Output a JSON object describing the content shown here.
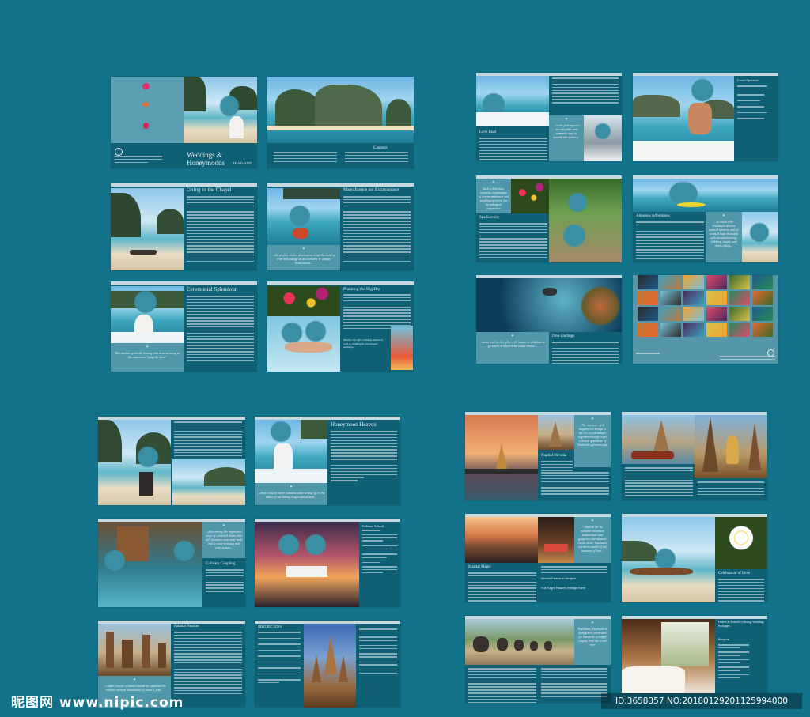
{
  "brochure": {
    "cover_title": "Weddings & Honeymoons",
    "brand": "THAILAND",
    "contents_heading": "Contents",
    "contents_items": [
      "Going to the Chapel",
      "Ceremonial Splendour",
      "Magnificence not Extravagance",
      "Planning the Big Day",
      "Honeymoon Heaven",
      "Culinary Coupling",
      "Palatial Passion",
      "Nuptial Nirvana",
      "Marital Magic",
      "Celebration of Love"
    ]
  },
  "pages": {
    "chapel": {
      "title": "Going to the Chapel"
    },
    "magnificence": {
      "title": "Magnificence not Extravagance",
      "quote": "...the perfect shelter destination to set the bond of love and indulge in an exclusive & unique honeymoon..."
    },
    "ceremonial": {
      "title": "Ceremonial Splendour",
      "quote": "This ancient symbolic joining rain term meaning to the expressive \"tying the knot\""
    },
    "planning": {
      "title": "Planning the Big Day",
      "quote": "Website list offer wedding advice as well as wedding & honeymoon packages"
    },
    "love_boat": {
      "title": "Love Boat",
      "quote": "...exotic journeys are an enjoyable and romantic way to unearth the scenery..."
    },
    "cruise_list": {
      "heading": "Cruise Operators"
    },
    "spa": {
      "title": "Spa Serenity",
      "quote": "Such a delicious, relaxing combination of serene ambience and soothing services, for an indulgent experience"
    },
    "amorous": {
      "title": "Amorous Adventures",
      "quote": "...to touch with Thailand's diverse natural scenery, and on a small bush thousand with mountaineering, trekking, jungle, and river rafting..."
    },
    "dive": {
      "title": "Dive Darlings",
      "quote": "...swim with turtles, play with turquoise dolphins or go shark or black-head whale sharks..."
    },
    "honeymoon_heaven": {
      "title": "Honeymoon Heaven",
      "quote": "...what could be more romantic than setting off in the allure of our breezy long tropical land..."
    },
    "culinary_schools": {
      "title": "Culinary Schools"
    },
    "culinary_coupling": {
      "title": "Culinary Coupling",
      "quote": "...discovering the impressive ways of colourful dishes that will stimulate your taste buds and so your honours and your senses..."
    },
    "palatial": {
      "title": "Palatial Passion",
      "quote": "...couple's hands to stand around the impressively ancient cultural monuments of historic past..."
    },
    "historic_sites": {
      "heading": "HISTORIC SITES"
    },
    "nuptial": {
      "title": "Nuptial Nirvana",
      "quote": "The romance of a happier era beings to the air as you sample together through local colonial splendour of Thailand's glorious past"
    },
    "marital": {
      "title": "Marital Magic",
      "quote": "...famous for its romantic mountain temperature and gorgeous and majestic chedis & the Thailand's northern citadel of the romance of love..."
    },
    "marital_sub": {
      "title": "Mahidol Palaces in Bangkok",
      "line2": "H.M. King's Palace's Heritage Home"
    },
    "celebration": {
      "title": "Celebration of Love"
    },
    "elephant": {
      "quote": "Thailand's Elephants in Bangkok is celebrated for hundreds of happy couples from the world over"
    },
    "hotels": {
      "heading": "Hotels & Resorts Offering Wedding Packages",
      "sub": "Bangkok"
    }
  },
  "watermark": {
    "site": "昵图网 www.nipic.com",
    "id": "ID:3658357 NO:20180129201125994000"
  }
}
